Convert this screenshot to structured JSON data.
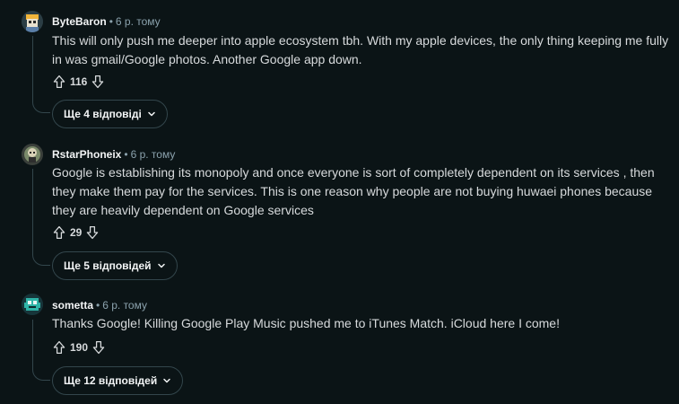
{
  "comments": [
    {
      "author": "ByteBaron",
      "separator": "•",
      "time": "6 р. тому",
      "text": "This will only push me deeper into apple ecosystem tbh. With my apple devices, the only thing keeping me fully in was gmail/Google photos. Another Google app down.",
      "score": "116",
      "more_replies": "Ще 4 відповіді"
    },
    {
      "author": "RstarPhoneix",
      "separator": "•",
      "time": "6 р. тому",
      "text": "Google is establishing its monopoly and once everyone is sort of completely dependent on its services , then they make them pay for the services. This is one reason why people are not buying huwaei phones because they are heavily dependent on Google services",
      "score": "29",
      "more_replies": "Ще 5 відповідей"
    },
    {
      "author": "sometta",
      "separator": "•",
      "time": "6 р. тому",
      "text": "Thanks Google! Killing Google Play Music pushed me to iTunes Match. iCloud here I come!",
      "score": "190",
      "more_replies": "Ще 12 відповідей"
    }
  ],
  "icons": {
    "upvote": "upvote-arrow-icon",
    "downvote": "downvote-arrow-icon",
    "chevron": "chevron-down-icon"
  },
  "colors": {
    "background": "#0b1416",
    "text": "#d7dadc",
    "muted": "#8ba2ad",
    "border": "#33464c"
  }
}
